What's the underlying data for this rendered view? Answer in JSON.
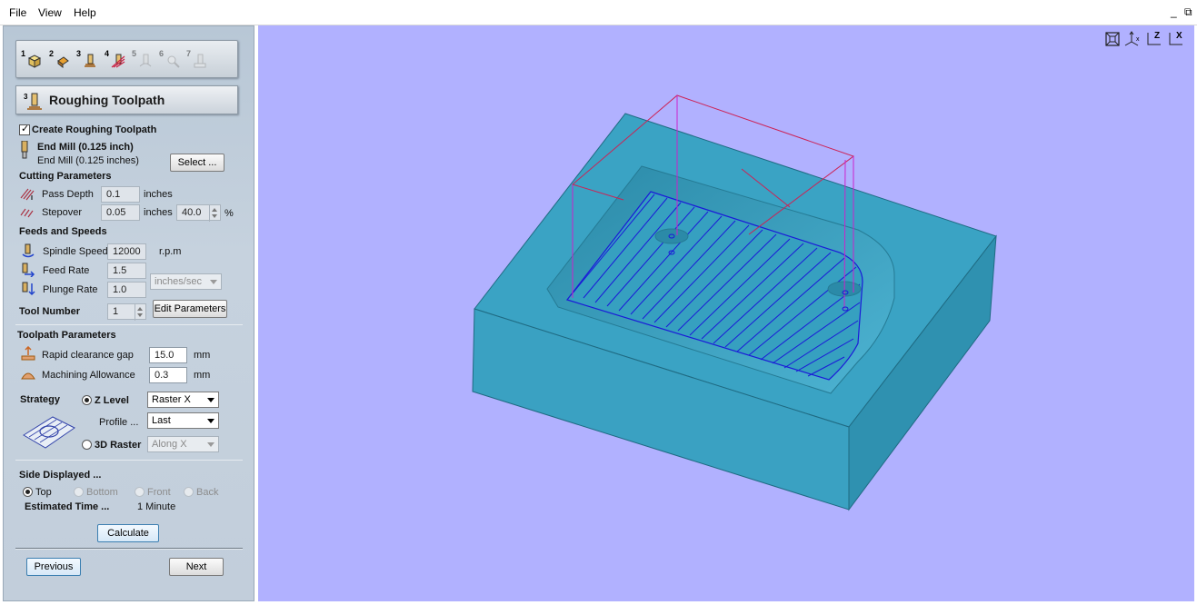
{
  "menu": {
    "file": "File",
    "view": "View",
    "help": "Help"
  },
  "window": {
    "minimize_glyph": "_",
    "restore_glyph": "⧉"
  },
  "steps": [
    {
      "num": "1",
      "icon": "material-setup-icon"
    },
    {
      "num": "2",
      "icon": "model-position-icon"
    },
    {
      "num": "3",
      "icon": "roughing-icon"
    },
    {
      "num": "4",
      "icon": "finishing-icon"
    },
    {
      "num": "5",
      "icon": "cutout-icon"
    },
    {
      "num": "6",
      "icon": "preview-icon"
    },
    {
      "num": "7",
      "icon": "save-toolpath-icon"
    }
  ],
  "panel": {
    "title_num": "3",
    "title": "Roughing Toolpath",
    "create_roughing": "Create Roughing Toolpath",
    "tool_name_bold": "End Mill (0.125 inch)",
    "tool_name": "End Mill (0.125 inches)",
    "select_button": "Select ...",
    "cutting_parameters": "Cutting Parameters",
    "pass_depth_label": "Pass Depth",
    "pass_depth_value": "0.1",
    "pass_depth_unit": "inches",
    "stepover_label": "Stepover",
    "stepover_value": "0.05",
    "stepover_unit": "inches",
    "stepover_percent": "40.0",
    "percent_sign": "%",
    "feeds_speeds": "Feeds and Speeds",
    "spindle_label": "Spindle Speed",
    "spindle_value": "12000",
    "spindle_unit": "r.p.m",
    "feed_label": "Feed Rate",
    "feed_value": "1.5",
    "plunge_label": "Plunge Rate",
    "plunge_value": "1.0",
    "rate_unit": "inches/sec",
    "tool_number_label": "Tool Number",
    "tool_number_value": "1",
    "edit_parameters": "Edit Parameters",
    "toolpath_parameters": "Toolpath Parameters",
    "rapid_label": "Rapid clearance gap",
    "rapid_value": "15.0",
    "rapid_unit": "mm",
    "allowance_label": "Machining Allowance",
    "allowance_value": "0.3",
    "allowance_unit": "mm",
    "strategy_label": "Strategy",
    "z_level": "Z Level",
    "z_level_option": "Raster X",
    "profile_label": "Profile ...",
    "profile_option": "Last",
    "raster_3d": "3D Raster",
    "raster_option": "Along X",
    "side_displayed": "Side Displayed ...",
    "side_top": "Top",
    "side_bottom": "Bottom",
    "side_front": "Front",
    "side_back": "Back",
    "estimated_time_label": "Estimated Time ...",
    "estimated_time_value": "1 Minute",
    "calculate": "Calculate",
    "previous": "Previous",
    "next": "Next"
  },
  "view_tools": [
    {
      "icon": "zoom-extents-icon"
    },
    {
      "icon": "iso-view-icon",
      "label": "x"
    },
    {
      "icon": "top-view-icon",
      "label": "Z"
    },
    {
      "icon": "front-view-icon",
      "label": "X"
    }
  ],
  "colors": {
    "viewport_bg": "#b1b1ff",
    "block_top": "#3ba2c3",
    "block_front": "#3ba0c0",
    "block_side": "#2f8fad",
    "toolpath_blue": "#1a1ad8",
    "toolpath_red": "#cc2255",
    "toolpath_magenta": "#cc22cc"
  }
}
